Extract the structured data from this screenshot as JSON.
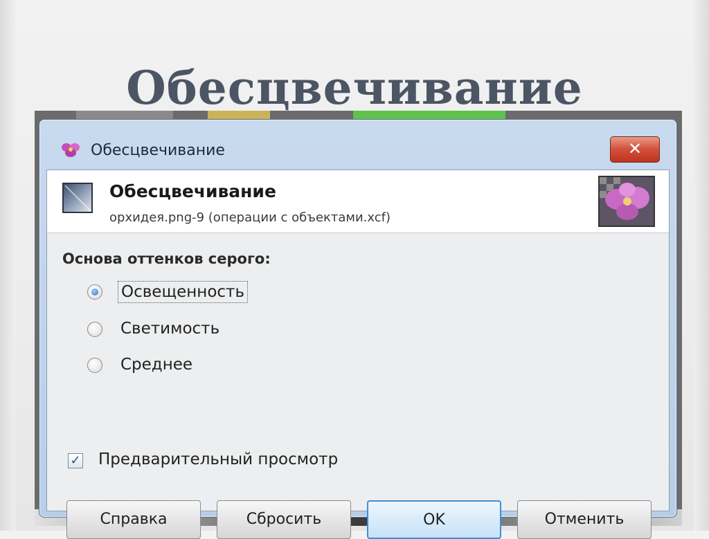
{
  "slide": {
    "title": "Обесцвечивание"
  },
  "dialog": {
    "title": "Обесцвечивание",
    "close_label": "✕",
    "header": {
      "title": "Обесцвечивание",
      "subtitle": "орхидея.png-9 (операции с объектами.xcf)"
    },
    "group_label": "Основа оттенков серого:",
    "options": [
      {
        "label": "Освещенность",
        "checked": true
      },
      {
        "label": "Светимость",
        "checked": false
      },
      {
        "label": "Среднее",
        "checked": false
      }
    ],
    "preview": {
      "label": "Предварительный просмотр",
      "checked": true,
      "mark": "✓"
    },
    "buttons": {
      "help": "Справка",
      "reset": "Сбросить",
      "ok": "OK",
      "cancel": "Отменить"
    }
  },
  "colors": {
    "title_text": "#4c5564",
    "titlebar": "#c9daef",
    "close_button": "#c0341f",
    "primary_button_border": "#3c8fd6"
  }
}
